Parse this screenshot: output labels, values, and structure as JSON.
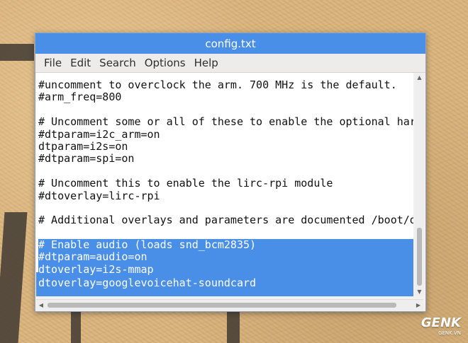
{
  "window": {
    "title": "config.txt"
  },
  "menu": [
    "File",
    "Edit",
    "Search",
    "Options",
    "Help"
  ],
  "editor": {
    "lines": [
      {
        "text": "#uncomment to overclock the arm. 700 MHz is the default.",
        "selected": false
      },
      {
        "text": "#arm_freq=800",
        "selected": false
      },
      {
        "text": "",
        "selected": false
      },
      {
        "text": "# Uncomment some or all of these to enable the optional hardware interfaces",
        "selected": false
      },
      {
        "text": "#dtparam=i2c_arm=on",
        "selected": false
      },
      {
        "text": "dtparam=i2s=on",
        "selected": false
      },
      {
        "text": "#dtparam=spi=on",
        "selected": false
      },
      {
        "text": "",
        "selected": false
      },
      {
        "text": "# Uncomment this to enable the lirc-rpi module",
        "selected": false
      },
      {
        "text": "#dtoverlay=lirc-rpi",
        "selected": false
      },
      {
        "text": "",
        "selected": false
      },
      {
        "text": "# Additional overlays and parameters are documented /boot/overlays/README",
        "selected": false
      },
      {
        "text": "",
        "selected": false
      },
      {
        "text": "# Enable audio (loads snd_bcm2835)",
        "selected": true
      },
      {
        "text": "#dtparam=audio=on",
        "selected": true
      },
      {
        "text": "dtoverlay=i2s-mmap",
        "selected": true
      },
      {
        "text": "dtoverlay=googlevoicehat-soundcard",
        "selected": true
      }
    ]
  },
  "watermark": {
    "brand": "GENK",
    "sub": "GENK.VN"
  },
  "colors": {
    "titlebar": "#4a8fe7",
    "selection": "#4a8fe7"
  }
}
